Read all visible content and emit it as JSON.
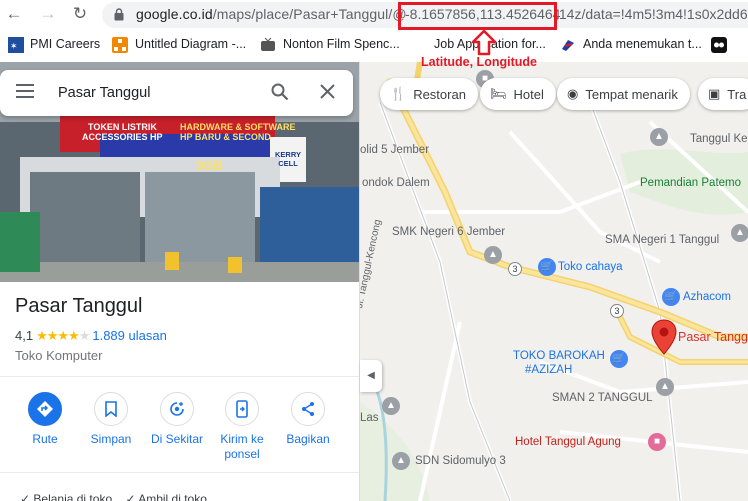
{
  "browser": {
    "url_host": "google.co.id",
    "url_path": "/maps/place/Pasar+Tanggul/@",
    "url_coords": "-8.1657856,113.4526464",
    "url_tail": ",14z/data=!4m5!3m4!1s0x2dd6",
    "bookmarks": [
      {
        "label": "PMI Careers",
        "icon": "pmi-icon"
      },
      {
        "label": "Untitled Diagram -...",
        "icon": "drawio-icon"
      },
      {
        "label": "Nonton Film Spenc...",
        "icon": "tv-icon"
      },
      {
        "label": "Job Application for...",
        "icon": "blank-icon"
      },
      {
        "label": "Anda menemukan t...",
        "icon": "brand-icon"
      },
      {
        "label": "",
        "icon": "media-icon"
      }
    ]
  },
  "annotation": {
    "label": "Latitude, Longitude",
    "color": "#e11a26"
  },
  "panel": {
    "search_value": "Pasar Tanggul",
    "photo_signs": [
      "TOKEN LISTRIK",
      "ACCESSORIES HP",
      "HARDWARE & SOFTWARE",
      "HP BARU & SECOND",
      "3GB",
      "KERRY CELL"
    ],
    "place_name": "Pasar Tanggul",
    "rating": "4,1",
    "stars": 4,
    "reviews": "1.889 ulasan",
    "category": "Toko Komputer",
    "actions": [
      {
        "label": "Rute",
        "icon": "directions-icon"
      },
      {
        "label": "Simpan",
        "icon": "bookmark-icon"
      },
      {
        "label": "Di Sekitar",
        "icon": "nearby-icon"
      },
      {
        "label": "Kirim ke ponsel",
        "icon": "send-to-phone-icon"
      },
      {
        "label": "Bagikan",
        "icon": "share-icon"
      }
    ],
    "bottom_hint_1": "Belanja di toko",
    "bottom_hint_2": "Ambil di toko"
  },
  "map": {
    "chips": [
      {
        "label": "Restoran",
        "icon": "restaurant-icon"
      },
      {
        "label": "Hotel",
        "icon": "hotel-icon"
      },
      {
        "label": "Tempat menarik",
        "icon": "camera-icon"
      },
      {
        "label": "Tra",
        "icon": "transit-icon"
      }
    ],
    "labels": {
      "tanggul_kecam": "Tanggul Kecam",
      "pemandian": "Pemandian Patemo",
      "sma1": "SMA Negeri 1 Tanggul",
      "smp5": "olid 5 Jember",
      "pondok": "ondok Dalem",
      "smk6": "SMK Negeri 6 Jember",
      "toko_cahaya": "Toko cahaya",
      "azhacom": "Azhacom",
      "pasar": "Pasar Tanggu",
      "barokah1": "TOKO BAROKAH",
      "barokah2": "#AZIZAH",
      "sman2": "SMAN 2 TANGGUL",
      "hotel": "Hotel Tanggul Agung",
      "sdn": "SDN Sidomulyo 3",
      "las": "Las",
      "road": "Jl. Tanggul-Kencong",
      "route_3a": "3",
      "route_3b": "3"
    }
  }
}
